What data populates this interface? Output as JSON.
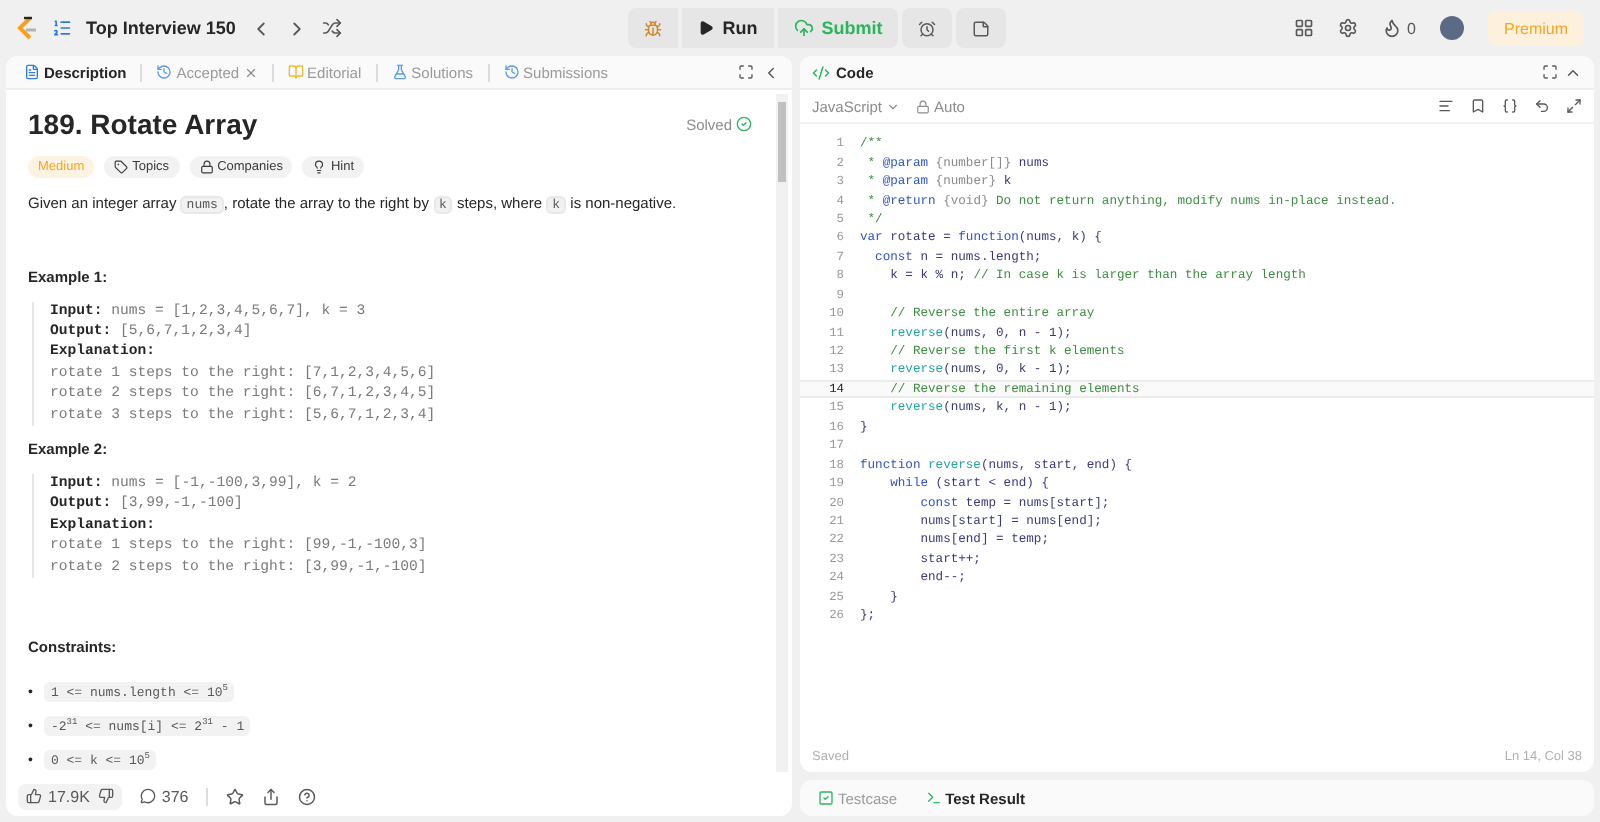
{
  "top_bar": {
    "list_title": "Top Interview 150",
    "run": "Run",
    "submit": "Submit",
    "streak": "0",
    "premium": "Premium"
  },
  "description_tabs": [
    {
      "label": "Description",
      "selected": true
    },
    {
      "label": "Accepted",
      "selected": false,
      "closable": true
    },
    {
      "label": "Editorial",
      "selected": false
    },
    {
      "label": "Solutions",
      "selected": false
    },
    {
      "label": "Submissions",
      "selected": false
    }
  ],
  "problem": {
    "title": "189. Rotate Array",
    "status": "Solved",
    "solved": true,
    "tags": [
      {
        "label": "Medium",
        "kind": "difficulty"
      },
      {
        "label": "Topics",
        "kind": "tag"
      },
      {
        "label": "Companies",
        "kind": "lock"
      },
      {
        "label": "Hint",
        "kind": "bulb"
      }
    ],
    "statement": [
      {
        "kind": "text",
        "text": "Given an integer array "
      },
      {
        "kind": "code",
        "text": "nums"
      },
      {
        "kind": "text",
        "text": ", rotate the array to the right by "
      },
      {
        "kind": "code",
        "text": "k"
      },
      {
        "kind": "text",
        "text": " steps, where "
      },
      {
        "kind": "code",
        "text": "k"
      },
      {
        "kind": "text",
        "text": " is non-negative."
      }
    ],
    "examples": [
      {
        "heading": "Example 1:",
        "lines": [
          "**Input:** nums = [1,2,3,4,5,6,7], k = 3",
          "**Output:** [5,6,7,1,2,3,4]",
          "**Explanation:**",
          "rotate 1 steps to the right: [7,1,2,3,4,5,6]",
          "rotate 2 steps to the right: [6,7,1,2,3,4,5]",
          "rotate 3 steps to the right: [5,6,7,1,2,3,4]"
        ]
      },
      {
        "heading": "Example 2:",
        "lines": [
          "**Input:** nums = [-1,-100,3,99], k = 2",
          "**Output:** [3,99,-1,-100]",
          "**Explanation:**",
          "rotate 1 steps to the right: [99,-1,-100,3]",
          "rotate 2 steps to the right: [3,99,-1,-100]"
        ]
      }
    ],
    "constraints_heading": "Constraints:",
    "constraints": [
      {
        "marker": "•",
        "text": "1 <= nums.length <= 10$^{5}$"
      },
      {
        "marker": "•",
        "text": "-2$^{31}$ <= nums[i] <= 2$^{31}$ - 1"
      },
      {
        "marker": "•",
        "text": "0 <= k <= 10$^{5}$"
      }
    ]
  },
  "description_footer": {
    "likes": "17.9K",
    "comments": "376"
  },
  "code_panel": {
    "title": "Code",
    "language": "JavaScript",
    "mode": "Auto",
    "lines": [
      {
        "n": "1",
        "active": false,
        "seg": [
          {
            "kind": "comment",
            "text": "/**"
          }
        ]
      },
      {
        "n": "2",
        "active": false,
        "seg": [
          {
            "kind": "comment",
            "text": " * "
          },
          {
            "kind": "doctag",
            "text": "@param"
          },
          {
            "kind": "type",
            "text": " {number[]} "
          },
          {
            "kind": "plain",
            "text": "nums"
          }
        ]
      },
      {
        "n": "3",
        "active": false,
        "seg": [
          {
            "kind": "comment",
            "text": " * "
          },
          {
            "kind": "doctag",
            "text": "@param"
          },
          {
            "kind": "type",
            "text": " {number} "
          },
          {
            "kind": "plain",
            "text": "k"
          }
        ]
      },
      {
        "n": "4",
        "active": false,
        "seg": [
          {
            "kind": "comment",
            "text": " * "
          },
          {
            "kind": "doctag",
            "text": "@return"
          },
          {
            "kind": "type",
            "text": " {void} "
          },
          {
            "kind": "comment",
            "text": "Do not return anything, modify nums in-place instead."
          }
        ]
      },
      {
        "n": "5",
        "active": false,
        "seg": [
          {
            "kind": "comment",
            "text": " */"
          }
        ]
      },
      {
        "n": "6",
        "active": false,
        "seg": [
          {
            "kind": "keyword",
            "text": "var"
          },
          {
            "kind": "plain",
            "text": " rotate = "
          },
          {
            "kind": "keyword",
            "text": "function"
          },
          {
            "kind": "plain",
            "text": "(nums, k) {"
          }
        ]
      },
      {
        "n": "7",
        "active": false,
        "seg": [
          {
            "kind": "keyword",
            "text": "  const"
          },
          {
            "kind": "plain",
            "text": " n = nums.length;"
          }
        ]
      },
      {
        "n": "8",
        "active": false,
        "seg": [
          {
            "kind": "plain",
            "text": "    k = k % n; "
          },
          {
            "kind": "comment",
            "text": "// In case k is larger than the array length"
          }
        ]
      },
      {
        "n": "9",
        "active": false
      },
      {
        "n": "10",
        "active": false,
        "seg": [
          {
            "kind": "comment",
            "text": "    // Reverse the entire array"
          }
        ]
      },
      {
        "n": "11",
        "active": false,
        "seg": [
          {
            "kind": "call",
            "text": "    reverse"
          },
          {
            "kind": "plain",
            "text": "(nums, 0, n - 1);"
          }
        ]
      },
      {
        "n": "12",
        "active": false,
        "seg": [
          {
            "kind": "comment",
            "text": "    // Reverse the first k elements"
          }
        ]
      },
      {
        "n": "13",
        "active": false,
        "seg": [
          {
            "kind": "call",
            "text": "    reverse"
          },
          {
            "kind": "plain",
            "text": "(nums, 0, k - 1);"
          }
        ]
      },
      {
        "n": "14",
        "active": true,
        "seg": [
          {
            "kind": "comment",
            "text": "    // Reverse the remaining elements"
          }
        ]
      },
      {
        "n": "15",
        "active": false,
        "seg": [
          {
            "kind": "call",
            "text": "    reverse"
          },
          {
            "kind": "plain",
            "text": "(nums, k, n - 1);"
          }
        ]
      },
      {
        "n": "16",
        "active": false,
        "seg": [
          {
            "kind": "plain",
            "text": "}"
          }
        ]
      },
      {
        "n": "17",
        "active": false
      },
      {
        "n": "18",
        "active": false,
        "seg": [
          {
            "kind": "keyword",
            "text": "function"
          },
          {
            "kind": "call",
            "text": " reverse"
          },
          {
            "kind": "plain",
            "text": "(nums, start, end) {"
          }
        ]
      },
      {
        "n": "19",
        "active": false,
        "seg": [
          {
            "kind": "keyword",
            "text": "    while"
          },
          {
            "kind": "plain",
            "text": " (start < end) {"
          }
        ]
      },
      {
        "n": "20",
        "active": false,
        "seg": [
          {
            "kind": "keyword",
            "text": "        const"
          },
          {
            "kind": "plain",
            "text": " temp = nums[start];"
          }
        ]
      },
      {
        "n": "21",
        "active": false,
        "seg": [
          {
            "kind": "plain",
            "text": "        nums[start] = nums[end];"
          }
        ]
      },
      {
        "n": "22",
        "active": false,
        "seg": [
          {
            "kind": "plain",
            "text": "        nums[end] = temp;"
          }
        ]
      },
      {
        "n": "23",
        "active": false,
        "seg": [
          {
            "kind": "plain",
            "text": "        start++;"
          }
        ]
      },
      {
        "n": "24",
        "active": false,
        "seg": [
          {
            "kind": "plain",
            "text": "        end--;"
          }
        ]
      },
      {
        "n": "25",
        "active": false,
        "seg": [
          {
            "kind": "plain",
            "text": "    }"
          }
        ]
      },
      {
        "n": "26",
        "active": false,
        "seg": [
          {
            "kind": "plain",
            "text": "};"
          }
        ]
      }
    ],
    "save_state": "Saved",
    "cursor": "Ln 14, Col 38"
  },
  "console_tabs": [
    {
      "label": "Testcase",
      "selected": false
    },
    {
      "label": "Test Result",
      "selected": true
    }
  ]
}
